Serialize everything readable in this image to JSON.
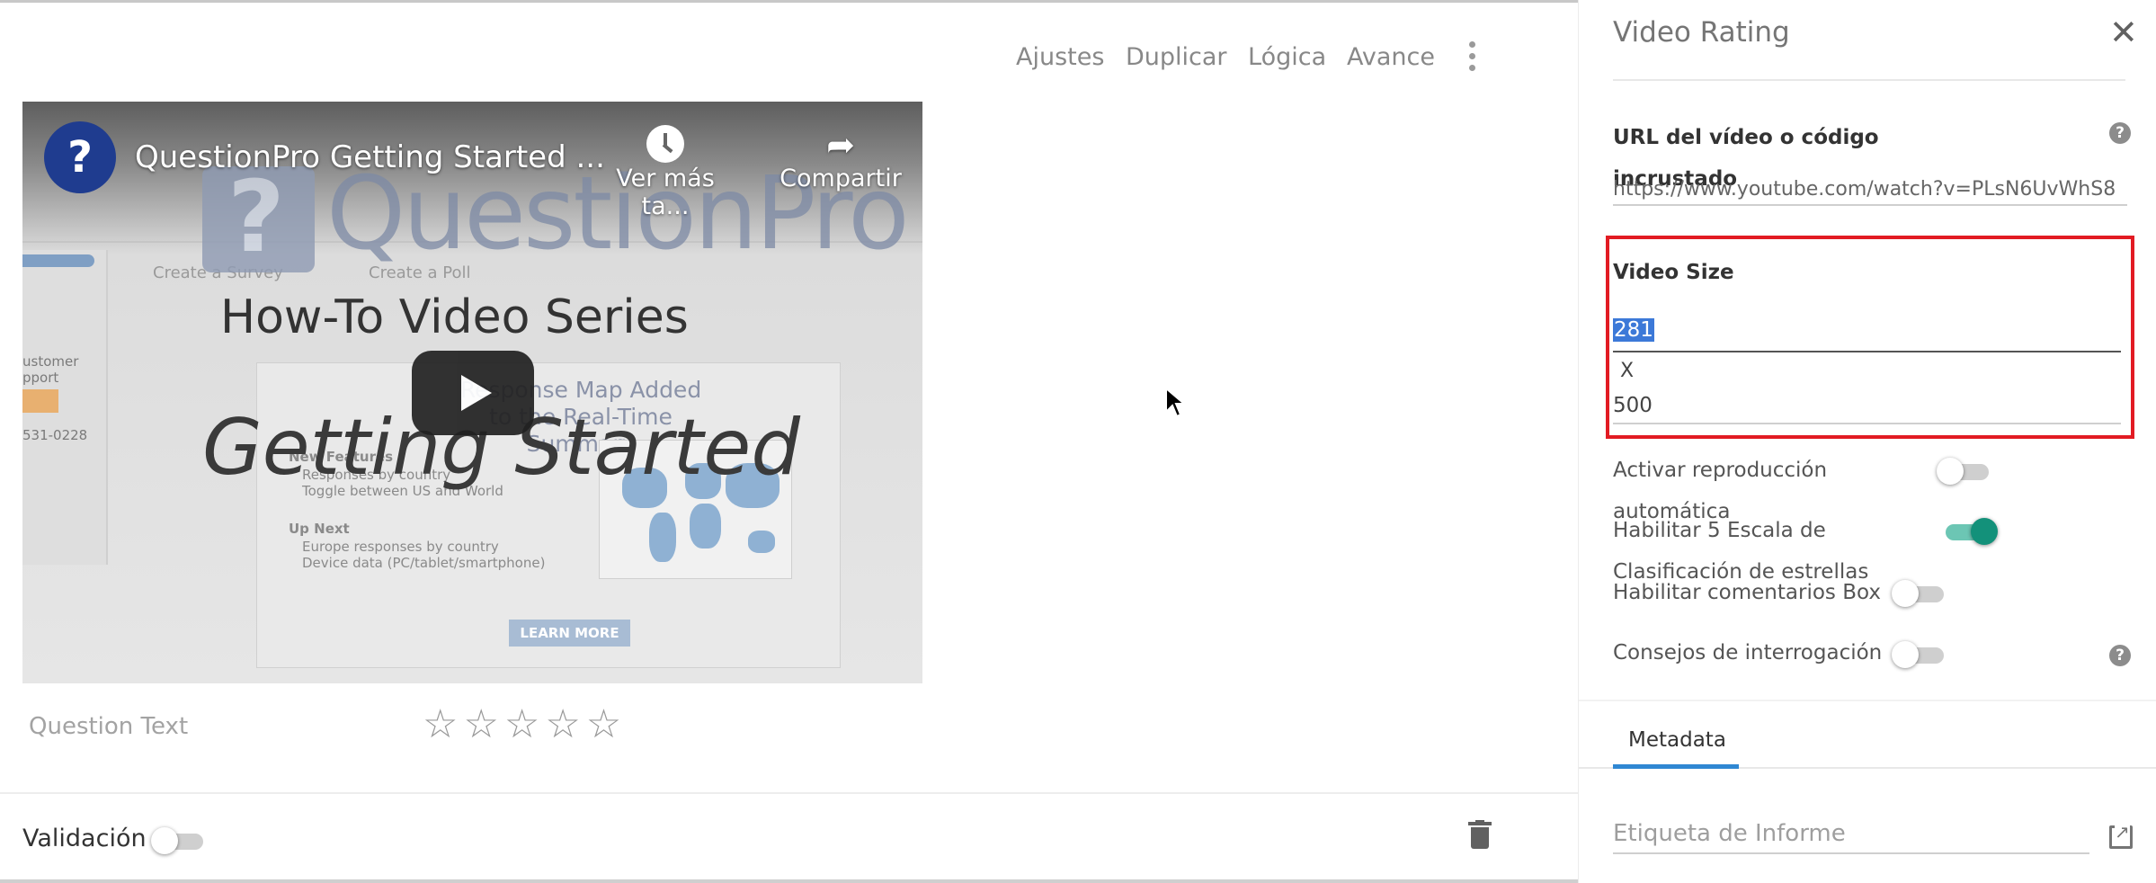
{
  "toolbar": {
    "settings": "Ajustes",
    "duplicate": "Duplicar",
    "logic": "Lógica",
    "advance": "Avance"
  },
  "video": {
    "channel_initial": "?",
    "title": "QuestionPro Getting Started ...",
    "watch_later": "Ver más ta...",
    "share": "Compartir",
    "logo_text": "QuestionPro",
    "headline": "How-To Video Series",
    "subheadline": "Getting Started",
    "tab_survey": "Create a Survey",
    "tab_poll": "Create a Poll",
    "card_title": "Response Map Added to the Real-Time Summary",
    "card_features": "New Features",
    "card_feature_1": "Responses by country",
    "card_feature_2": "Toggle between US and World",
    "card_upnext": "Up Next",
    "card_next_1": "Europe responses by country",
    "card_next_2": "Device data (PC/tablet/smartphone)",
    "learn_more": "LEARN MORE",
    "side_customer": "ustomer",
    "side_support": "pport",
    "side_phone": "531-0228"
  },
  "question": {
    "text": "Question Text",
    "stars": "☆☆☆☆☆",
    "star_count": 5
  },
  "validation": {
    "label": "Validación",
    "enabled": false
  },
  "panel": {
    "title": "Video Rating",
    "close": "✕",
    "url_label": "URL del vídeo o código incrustado",
    "url_value": "https://www.youtube.com/watch?v=PLsN6UvWhS8",
    "size_label": "Video Size",
    "size_width": "281",
    "size_x": "X",
    "size_height": "500",
    "autoplay_label": "Activar reproducción automática",
    "autoplay_enabled": false,
    "stars_label": "Habilitar 5 Escala de Clasificación de estrellas",
    "stars_enabled": true,
    "comments_label": "Habilitar comentarios Box",
    "comments_enabled": false,
    "tips_label": "Consejos de interrogación",
    "tips_enabled": false,
    "tab_metadata": "Metadata",
    "report_placeholder": "Etiqueta de Informe"
  },
  "colors": {
    "accent": "#13917a",
    "highlight_border": "#e21b23",
    "tab_underline": "#2f87d3"
  }
}
